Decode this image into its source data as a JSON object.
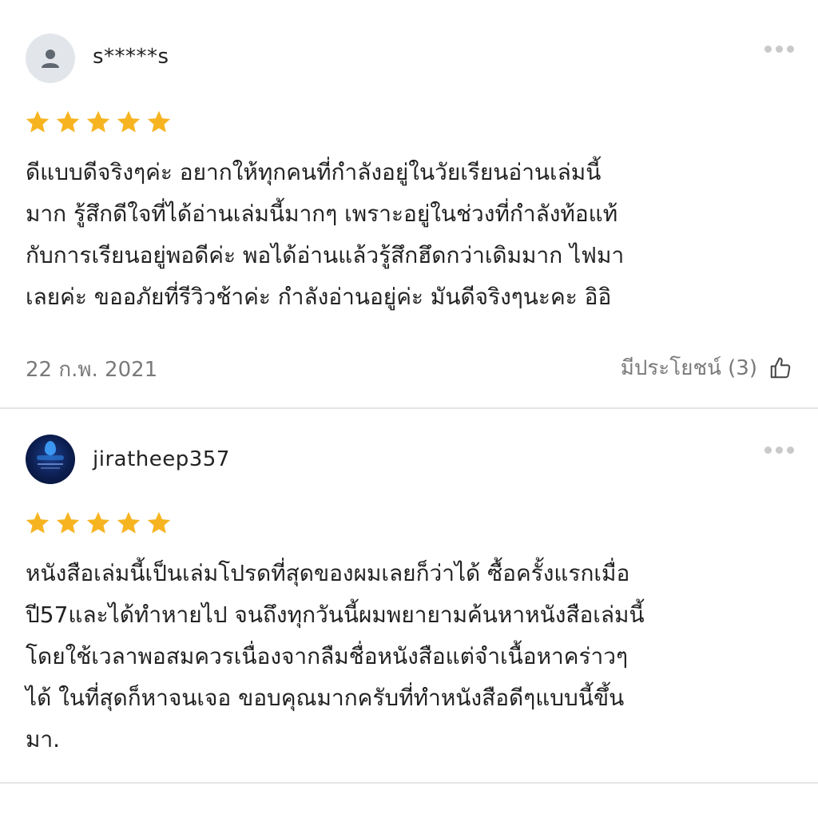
{
  "reviews": [
    {
      "username": "s*****s",
      "avatar_icon": "default-user-icon",
      "rating": 5,
      "text_lines": [
        "ดีแบบดีจริงๆค่ะ อยากให้ทุกคนที่กำลังอยู่ในวัยเรียนอ่านเล่มนี้",
        "มาก รู้สึกดีใจที่ได้อ่านเล่มนี้มากๆ เพราะอยู่ในช่วงที่กำลังท้อแท้",
        "กับการเรียนอยู่พอดีค่ะ พอได้อ่านแล้วรู้สึกฮึดกว่าเดิมมาก ไฟมา",
        "เลยค่ะ ขออภัยที่รีวิวช้าค่ะ กำลังอ่านอยู่ค่ะ มันดีจริงๆนะคะ อิอิ"
      ],
      "date": "22 ก.พ. 2021",
      "helpful_label": "มีประโยชน์ (3)"
    },
    {
      "username": "jiratheep357",
      "avatar_icon": "brand-logo-avatar",
      "rating": 5,
      "text_lines": [
        "หนังสือเล่มนี้เป็นเล่มโปรดที่สุดของผมเลยก็ว่าได้ ซื้อครั้งแรกเมื่อ",
        "ปี57และได้ทำหายไป จนถึงทุกวันนี้ผมพยายามค้นหาหนังสือเล่มนี้",
        "โดยใช้เวลาพอสมควรเนื่องจากลืมชื่อหนังสือแต่จำเนื้อหาคร่าวๆ",
        "ได้ ในที่สุดก็หาจนเจอ ขอบคุณมากครับที่ทำหนังสือดีๆแบบนี้ขึ้น",
        "มา."
      ]
    }
  ],
  "colors": {
    "star": "#f7b421",
    "muted_text": "#7a7a7a",
    "divider": "#e4e4e4"
  }
}
